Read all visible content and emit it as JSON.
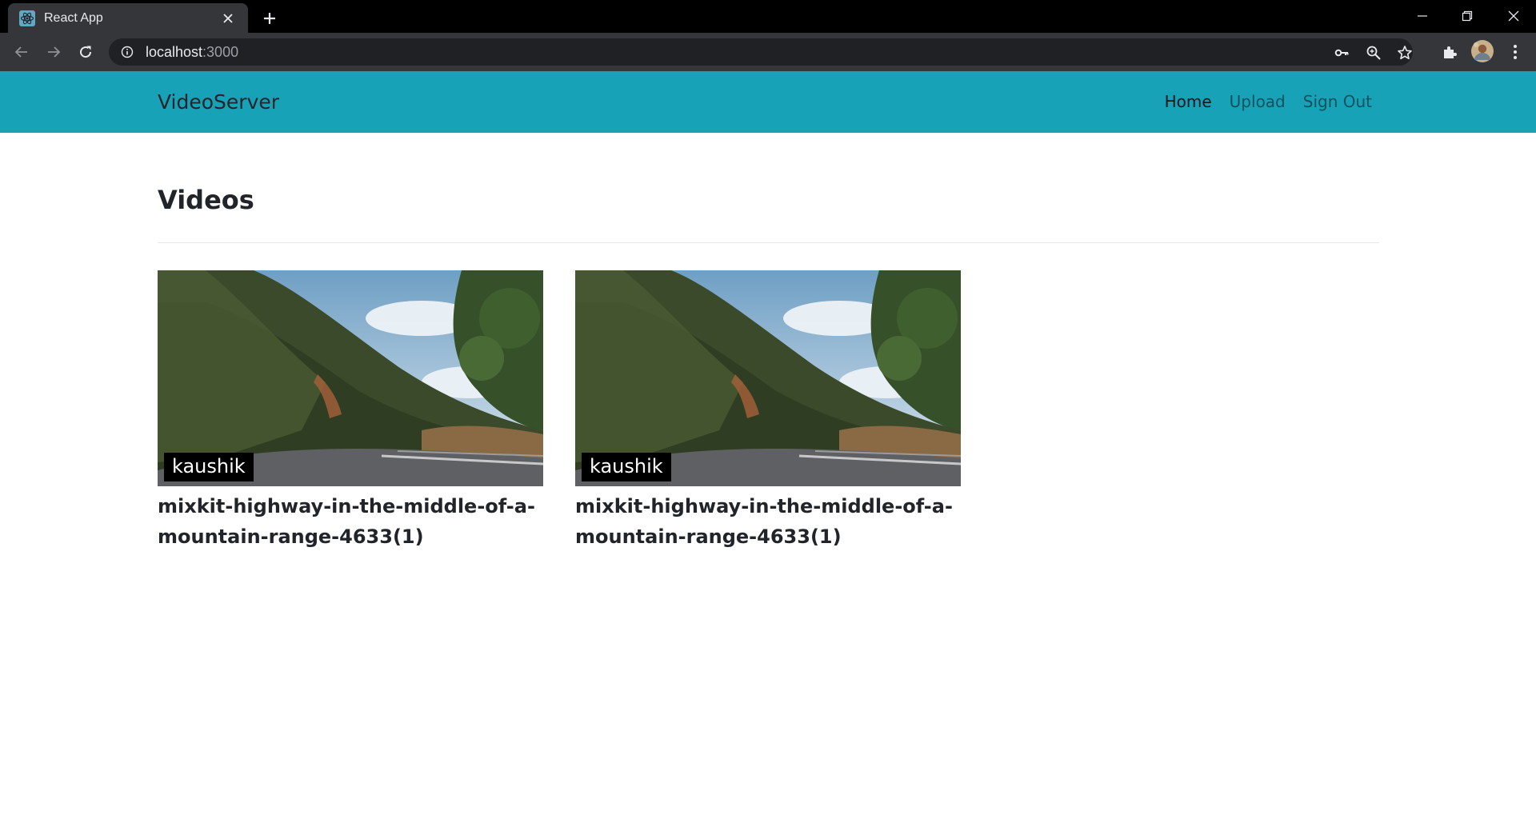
{
  "browser": {
    "tab_title": "React App",
    "url_host": "localhost",
    "url_port": ":3000"
  },
  "navbar": {
    "brand": "VideoServer",
    "links": [
      {
        "label": "Home",
        "active": true
      },
      {
        "label": "Upload",
        "active": false
      },
      {
        "label": "Sign Out",
        "active": false
      }
    ]
  },
  "main": {
    "heading": "Videos",
    "videos": [
      {
        "owner": "kaushik",
        "title": "mixkit-highway-in-the-middle-of-a-mountain-range-4633(1)"
      },
      {
        "owner": "kaushik",
        "title": "mixkit-highway-in-the-middle-of-a-mountain-range-4633(1)"
      }
    ]
  },
  "colors": {
    "navbar_bg": "#17a2b8",
    "browser_toolbar": "#35363a",
    "omnibox": "#202124"
  },
  "icons": [
    "react-favicon-icon",
    "close-icon",
    "plus-icon",
    "minimize-icon",
    "restore-icon",
    "window-close-icon",
    "back-icon",
    "forward-icon",
    "reload-icon",
    "info-icon",
    "key-icon",
    "zoom-icon",
    "star-icon",
    "puzzle-icon",
    "avatar",
    "kebab-menu-icon"
  ]
}
